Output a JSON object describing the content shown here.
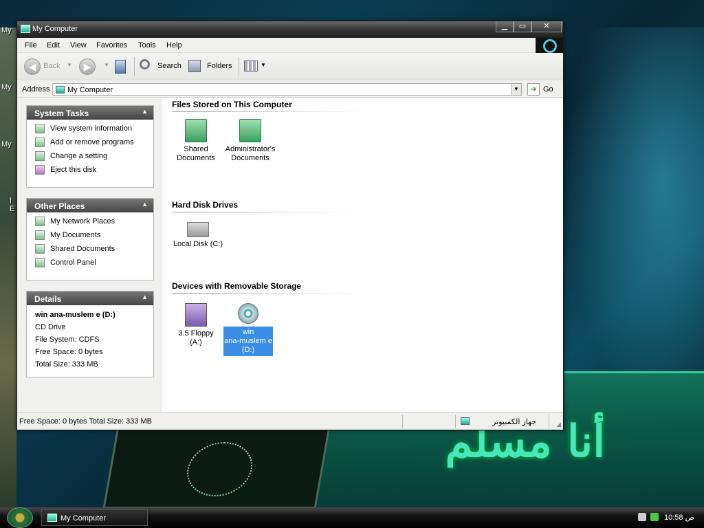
{
  "desktop": {
    "icon_labels": [
      "My",
      "My",
      "My",
      "I",
      "E"
    ],
    "wallpaper_text": "أنا مسلم"
  },
  "window": {
    "title": "My Computer",
    "buttons": {
      "minimize": "▁",
      "maximize": "▭",
      "close": "✕"
    }
  },
  "menu": {
    "items": [
      "File",
      "Edit",
      "View",
      "Favorites",
      "Tools",
      "Help"
    ]
  },
  "toolbar": {
    "back_label": "Back",
    "search_label": "Search",
    "folders_label": "Folders"
  },
  "address": {
    "label": "Address",
    "value": "My Computer",
    "go_label": "Go"
  },
  "sidebar": {
    "system_tasks": {
      "title": "System Tasks",
      "items": [
        "View system information",
        "Add or remove programs",
        "Change a setting",
        "Eject this disk"
      ]
    },
    "other_places": {
      "title": "Other Places",
      "items": [
        "My Network Places",
        "My Documents",
        "Shared Documents",
        "Control Panel"
      ]
    },
    "details": {
      "title": "Details",
      "name": "win ana-muslem e (D:)",
      "type": "CD Drive",
      "file_system": "File System: CDFS",
      "free_space": "Free Space: 0 bytes",
      "total_size": "Total Size: 333 MB"
    }
  },
  "main": {
    "sections": [
      {
        "title": "Files Stored on This Computer"
      },
      {
        "title": "Hard Disk Drives"
      },
      {
        "title": "Devices with Removable Storage"
      }
    ],
    "items": {
      "shared_docs": [
        "Shared",
        "Documents"
      ],
      "admin_docs": [
        "Administrator's",
        "Documents"
      ],
      "local_disk": [
        "Local Disk (C:)"
      ],
      "floppy": [
        "3.5 Floppy",
        "(A:)"
      ],
      "cd": [
        "win",
        "ana-muslem e",
        "(D:)"
      ]
    }
  },
  "status": {
    "text": "Free Space: 0 bytes Total Size: 333 MB",
    "zone": "جهاز الكمبيوتر"
  },
  "taskbar": {
    "task_label": "My Computer",
    "clock": "10:58 ص"
  }
}
